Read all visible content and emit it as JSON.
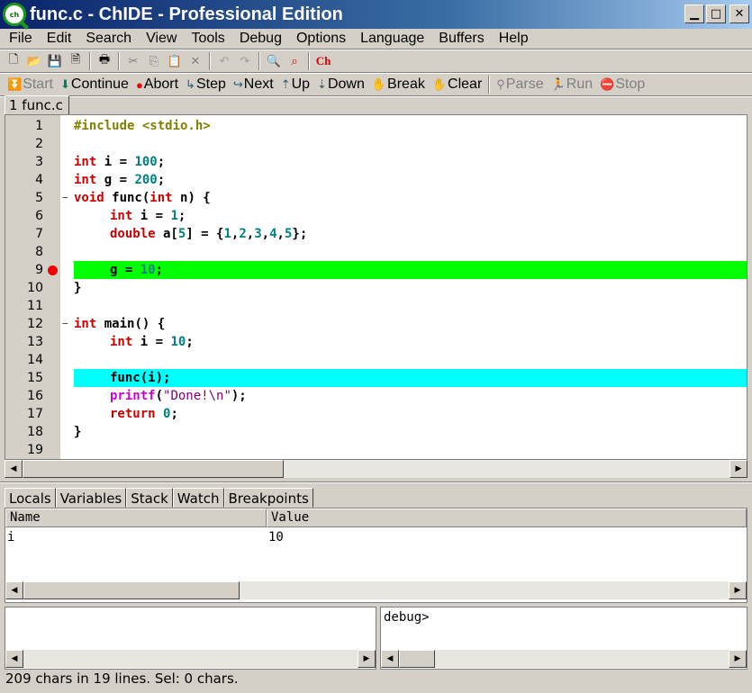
{
  "window": {
    "title": "func.c - ChIDE - Professional Edition",
    "app_icon_label": "ch"
  },
  "menu": [
    "File",
    "Edit",
    "Search",
    "View",
    "Tools",
    "Debug",
    "Options",
    "Language",
    "Buffers",
    "Help"
  ],
  "toolbar_debug": {
    "start": "Start",
    "continue": "Continue",
    "abort": "Abort",
    "step": "Step",
    "next": "Next",
    "up": "Up",
    "down": "Down",
    "break": "Break",
    "clear": "Clear",
    "parse": "Parse",
    "run": "Run",
    "stop": "Stop"
  },
  "file_tab": "1 func.c",
  "editor": {
    "line_numbers": [
      "1",
      "2",
      "3",
      "4",
      "5",
      "6",
      "7",
      "8",
      "9",
      "10",
      "11",
      "12",
      "13",
      "14",
      "15",
      "16",
      "17",
      "18",
      "19"
    ],
    "code": {
      "l1_pp": "#include <stdio.h>",
      "l3_kw": "int",
      "l3_a": " i = ",
      "l3_num": "100",
      "l3_b": ";",
      "l4_kw": "int",
      "l4_a": " g = ",
      "l4_num": "200",
      "l4_b": ";",
      "l5_kw1": "void",
      "l5_a": " func(",
      "l5_kw2": "int",
      "l5_b": " n) {",
      "l6_kw": "int",
      "l6_a": " i = ",
      "l6_num": "1",
      "l6_b": ";",
      "l7_kw": "double",
      "l7_a": " a[",
      "l7_n1": "5",
      "l7_b": "] = {",
      "l7_n2": "1",
      "l7_c1": ",",
      "l7_n3": "2",
      "l7_c2": ",",
      "l7_n4": "3",
      "l7_c3": ",",
      "l7_n5": "4",
      "l7_c4": ",",
      "l7_n6": "5",
      "l7_d": "};",
      "l9_a": "g = ",
      "l9_num": "10",
      "l9_b": ";",
      "l10": "}",
      "l12_kw": "int",
      "l12_a": " main() {",
      "l13_kw": "int",
      "l13_a": " i = ",
      "l13_num": "10",
      "l13_b": ";",
      "l15": "func(i);",
      "l16_fn": "printf",
      "l16_a": "(",
      "l16_str": "\"Done!\\n\"",
      "l16_b": ");",
      "l17_kw": "return",
      "l17_a": " ",
      "l17_num": "0",
      "l17_b": ";",
      "l18": "}"
    },
    "breakpoint_line": "9",
    "current_line": "9",
    "caller_line": "15"
  },
  "debug_tabs": [
    "Locals",
    "Variables",
    "Stack",
    "Watch",
    "Breakpoints"
  ],
  "locals": {
    "headers": {
      "name": "Name",
      "value": "Value"
    },
    "rows": [
      {
        "name": "i",
        "value": "10"
      }
    ]
  },
  "console": {
    "prompt": "debug>"
  },
  "status": "209 chars in 19 lines. Sel: 0 chars.",
  "colors": {
    "current_line_highlight": "#00ff00",
    "caller_line_highlight": "#00ffff",
    "keyword": "#cc0000",
    "number": "#008080",
    "preprocessor": "#808000",
    "function": "#cc00cc",
    "breakpoint": "#ee0000"
  }
}
